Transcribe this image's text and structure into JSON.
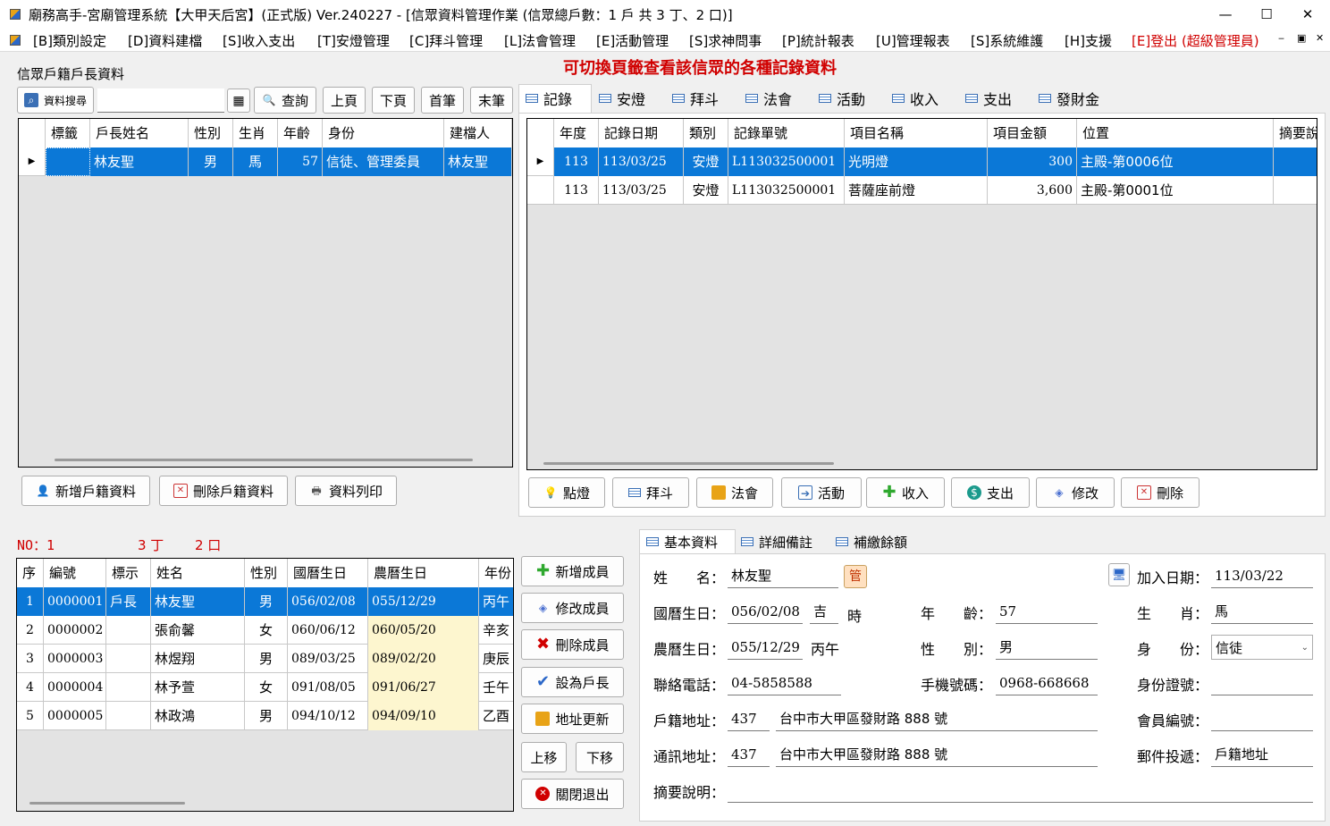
{
  "window": {
    "title": "廟務高手-宮廟管理系統【大甲天后宮】(正式版) Ver.240227 - [信眾資料管理作業 (信眾總戶數：1 戶  共 3 丁、2 口)]",
    "minimize": "—",
    "maximize": "☐",
    "close": "✕"
  },
  "menu": [
    "[B]類別設定",
    "[D]資料建檔",
    "[S]收入支出",
    "[T]安燈管理",
    "[C]拜斗管理",
    "[L]法會管理",
    "[E]活動管理",
    "[S]求神問事",
    "[P]統計報表",
    "[U]管理報表",
    "[S]系統維護",
    "[H]支援",
    "[E]登出 (超級管理員)"
  ],
  "household": {
    "group_label": "信眾戶籍戶長資料",
    "search_btn": "資料搜尋",
    "query_btn": "查詢",
    "prev_btn": "上頁",
    "next_btn": "下頁",
    "first_btn": "首筆",
    "last_btn": "末筆",
    "columns": [
      "標籤",
      "戶長姓名",
      "性別",
      "生肖",
      "年齡",
      "身份",
      "建檔人"
    ],
    "rows": [
      [
        "",
        "林友聖",
        "男",
        "馬",
        "57",
        "信徒、管理委員",
        "林友聖"
      ]
    ],
    "add_btn": "新增戶籍資料",
    "del_btn": "刪除戶籍資料",
    "print_btn": "資料列印"
  },
  "hint": "可切換頁籤查看該信眾的各種記錄資料",
  "record_tabs": [
    "記錄",
    "安燈",
    "拜斗",
    "法會",
    "活動",
    "收入",
    "支出",
    "發財金"
  ],
  "records": {
    "columns": [
      "年度",
      "記錄日期",
      "類別",
      "記錄單號",
      "項目名稱",
      "項目金額",
      "位置",
      "摘要說"
    ],
    "rows": [
      [
        "113",
        "113/03/25",
        "安燈",
        "L113032500001",
        "光明燈",
        "300",
        "主殿-第0006位",
        ""
      ],
      [
        "113",
        "113/03/25",
        "安燈",
        "L113032500001",
        "菩薩座前燈",
        "3,600",
        "主殿-第0001位",
        ""
      ]
    ]
  },
  "record_buttons": [
    "點燈",
    "拜斗",
    "法會",
    "活動",
    "收入",
    "支出",
    "修改",
    "刪除"
  ],
  "members": {
    "summary": {
      "no": "NO：1",
      "ding": "3 丁",
      "kou": "2 口"
    },
    "columns": [
      "序",
      "編號",
      "標示",
      "姓名",
      "性別",
      "國曆生日",
      "農曆生日",
      "年份"
    ],
    "rows": [
      [
        "1",
        "0000001",
        "戶長",
        "林友聖",
        "男",
        "056/02/08",
        "055/12/29",
        "丙午"
      ],
      [
        "2",
        "0000002",
        "",
        "張俞馨",
        "女",
        "060/06/12",
        "060/05/20",
        "辛亥"
      ],
      [
        "3",
        "0000003",
        "",
        "林煜翔",
        "男",
        "089/03/25",
        "089/02/20",
        "庚辰"
      ],
      [
        "4",
        "0000004",
        "",
        "林予萱",
        "女",
        "091/08/05",
        "091/06/27",
        "壬午"
      ],
      [
        "5",
        "0000005",
        "",
        "林政鴻",
        "男",
        "094/10/12",
        "094/09/10",
        "乙酉"
      ]
    ],
    "buttons": {
      "add": "新增成員",
      "edit": "修改成員",
      "del": "刪除成員",
      "head": "設為戶長",
      "addr": "地址更新",
      "up": "上移",
      "down": "下移",
      "close": "關閉退出"
    }
  },
  "detail_tabs": [
    "基本資料",
    "詳細備註",
    "補繳餘額"
  ],
  "detail": {
    "name_lbl": "姓　　名：",
    "name": "林友聖",
    "manage_badge": "管",
    "join_lbl": "加入日期：",
    "join": "113/03/22",
    "solar_lbl": "國曆生日：",
    "solar": "056/02/08",
    "hour": "吉",
    "hour_unit": "時",
    "age_lbl": "年　　齡：",
    "age": "57",
    "zodiac_lbl": "生　　肖：",
    "zodiac": "馬",
    "lunar_lbl": "農曆生日：",
    "lunar": "055/12/29",
    "ganzhi": "丙午",
    "gender_lbl": "性　　別：",
    "gender": "男",
    "identity_lbl": "身　　份：",
    "identity": "信徒",
    "phone_lbl": "聯絡電話：",
    "phone": "04-5858588",
    "mobile_lbl": "手機號碼：",
    "mobile": "0968-668668",
    "idno_lbl": "身份證號：",
    "idno": "",
    "reg_addr_lbl": "戶籍地址：",
    "reg_zip": "437",
    "reg_addr": "台中市大甲區發財路 888 號",
    "member_no_lbl": "會員編號：",
    "member_no": "",
    "mail_addr_lbl": "通訊地址：",
    "mail_zip": "437",
    "mail_addr": "台中市大甲區發財路 888 號",
    "post_lbl": "郵件投遞：",
    "post": "戶籍地址",
    "memo_lbl": "摘要說明：",
    "memo": ""
  }
}
